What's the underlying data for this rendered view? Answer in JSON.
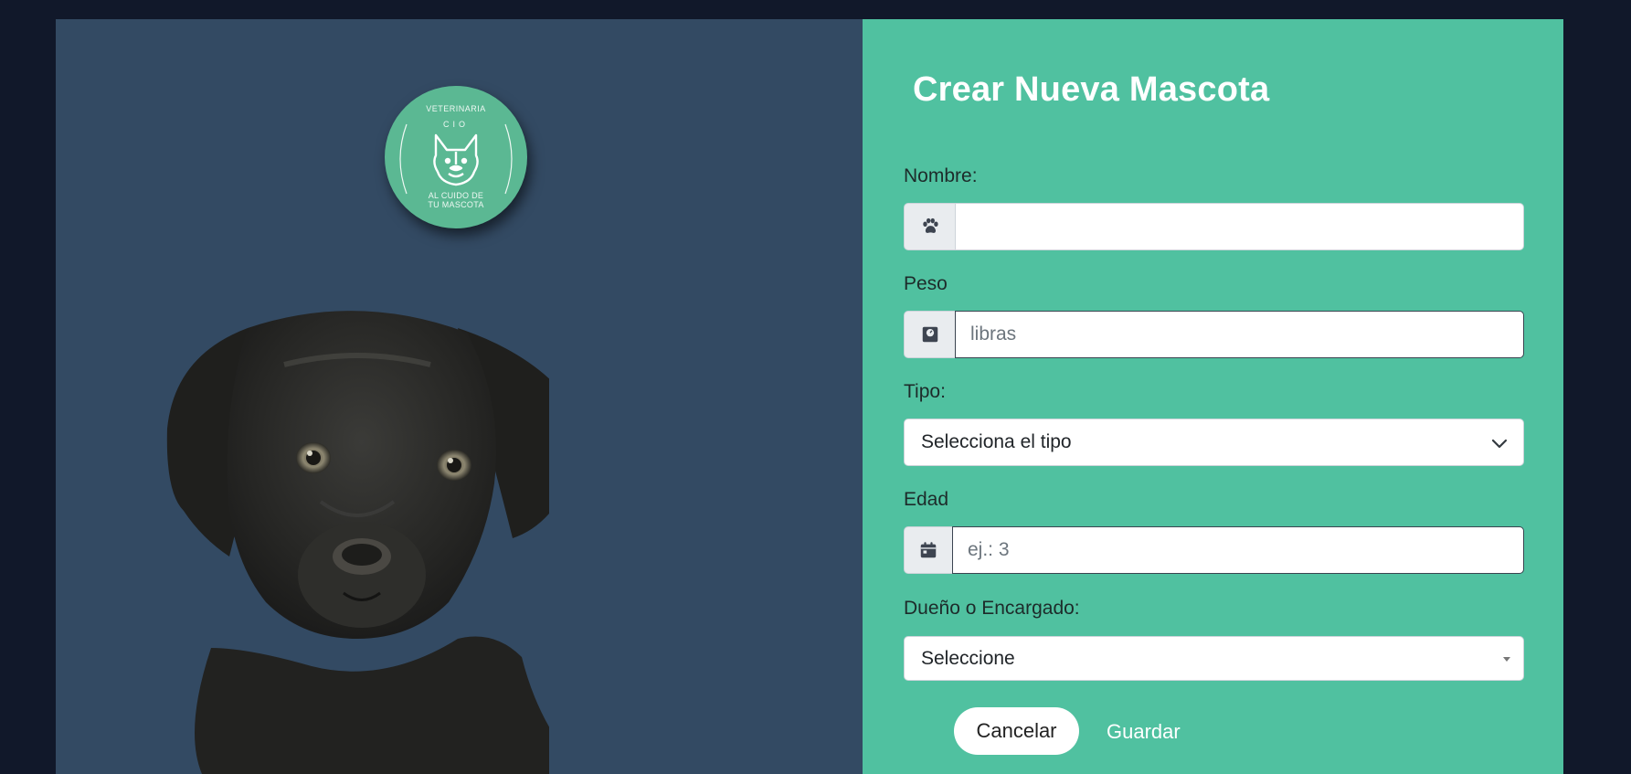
{
  "logo": {
    "line1": "VETERINARIA",
    "line2": "CIO",
    "line3a": "AL CUIDO DE",
    "line3b": "TU MASCOTA"
  },
  "form": {
    "title": "Crear Nueva Mascota",
    "nombre": {
      "label": "Nombre:",
      "value": "",
      "placeholder": "",
      "icon": "paw-icon"
    },
    "peso": {
      "label": "Peso",
      "value": "",
      "placeholder": "libras",
      "icon": "scale-icon"
    },
    "tipo": {
      "label": "Tipo:",
      "selected": "Selecciona el tipo"
    },
    "edad": {
      "label": "Edad",
      "value": "",
      "placeholder": "ej.: 3",
      "icon": "calendar-icon"
    },
    "dueno": {
      "label": "Dueño o Encargado:",
      "selected": "Seleccione"
    },
    "cancel_label": "Cancelar",
    "save_label": "Guardar"
  },
  "colors": {
    "page_bg": "#11182a",
    "left_panel_bg": "#334a63",
    "right_panel_bg": "#50c1a0",
    "logo_bg": "#5bb893"
  }
}
